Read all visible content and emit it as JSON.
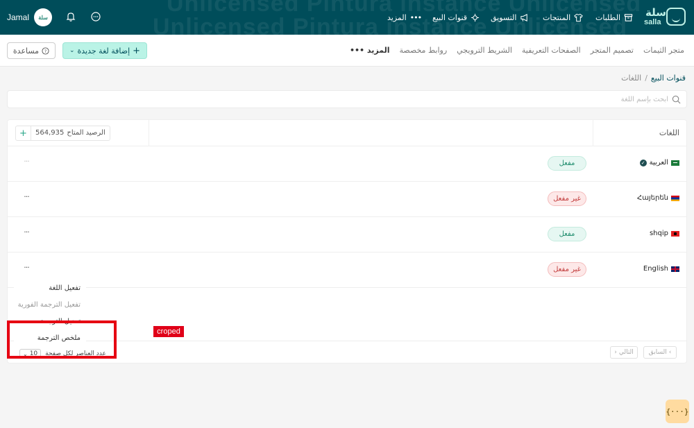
{
  "colors": {
    "topbar": "#004d5a",
    "accent": "#baf3e6",
    "active": "#1a8a6a",
    "inactive": "#c23b3b"
  },
  "topbar": {
    "watermark_line1": "Unlicensed Pintura instance Unlicensed",
    "watermark_line2": "Unlicensed Pintura instance Unlicensed",
    "logo_ar": "سلة",
    "logo_en": "salla",
    "nav": [
      {
        "label": "الطلبات",
        "icon": "box-icon"
      },
      {
        "label": "المنتجات",
        "icon": "shirt-icon"
      },
      {
        "label": "التسويق",
        "icon": "megaphone-icon"
      },
      {
        "label": "قنوات البيع",
        "icon": "channels-icon"
      },
      {
        "label": "المزيد",
        "icon": "more-dots-icon"
      }
    ],
    "user_name": "Jamal",
    "avatar_text": "سلة"
  },
  "subnav": {
    "tabs": [
      "متجر الثيمات",
      "تصميم المتجر",
      "الصفحات التعريفية",
      "الشريط الترويجي",
      "روابط مخصصة",
      "المزيد"
    ],
    "add_language": "إضافة لغة جديدة",
    "help": "مساعدة"
  },
  "breadcrumb": {
    "parent": "قنوات البيع",
    "separator": "/",
    "current": "اللغات"
  },
  "search": {
    "placeholder": "ابحث بإسم اللغة"
  },
  "table": {
    "column_header": "اللغات",
    "balance_label": "الرصيد المتاح",
    "balance_value": "564,935",
    "balance_plus": "+",
    "rows": [
      {
        "name": "العربية",
        "status": "مفعل",
        "active": true,
        "default": true
      },
      {
        "name": "Հայերեն",
        "status": "غير مفعل",
        "active": false,
        "default": false
      },
      {
        "name": "shqip",
        "status": "مفعل",
        "active": true,
        "default": false
      },
      {
        "name": "English",
        "status": "غير مفعل",
        "active": false,
        "default": false
      }
    ],
    "more_symbol": "···"
  },
  "dropdown": {
    "items": [
      "تفعيل اللغة",
      "تفعيل الترجمة الفورية",
      "تعديل الترجمة",
      "ملخص الترجمة"
    ]
  },
  "pagination": {
    "per_page_label": "عدد العناصر لكل صفحة",
    "per_page_value": "10",
    "prev": "السابق",
    "next": "التالي"
  },
  "annotation": {
    "label": "croped"
  },
  "code_button": "{···}"
}
